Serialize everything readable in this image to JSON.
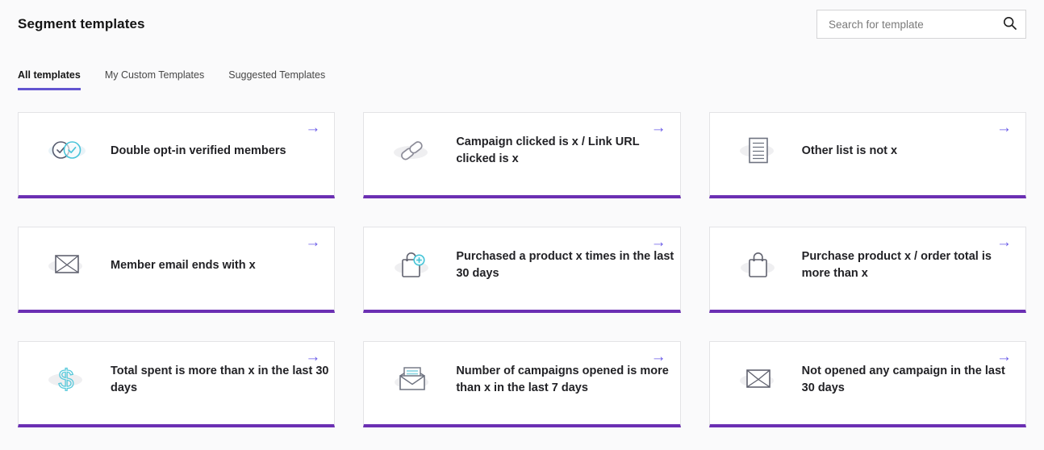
{
  "page": {
    "title": "Segment templates",
    "accent_border_color": "#6b2fb3",
    "arrow_color": "#6a5be8",
    "tab_underline_color": "#6254d0"
  },
  "search": {
    "placeholder": "Search for template",
    "value": "",
    "icon": "search-icon"
  },
  "tabs": [
    {
      "label": "All templates",
      "active": true
    },
    {
      "label": "My Custom Templates",
      "active": false
    },
    {
      "label": "Suggested Templates",
      "active": false
    }
  ],
  "card_arrow_glyph": "→",
  "cards": [
    {
      "title": "Double opt-in verified members",
      "icon": "double-optin-check-icon"
    },
    {
      "title": "Campaign clicked is x / Link URL clicked is x",
      "icon": "link-icon"
    },
    {
      "title": "Other list is not x",
      "icon": "list-document-icon"
    },
    {
      "title": "Member email ends with x",
      "icon": "envelope-icon"
    },
    {
      "title": "Purchased a product x times in the last 30 days",
      "icon": "shopping-bag-plus-icon"
    },
    {
      "title": "Purchase product x / order total is more than x",
      "icon": "shopping-bag-icon"
    },
    {
      "title": "Total spent is more than x in the last 30 days",
      "icon": "dollar-icon"
    },
    {
      "title": "Number of campaigns opened is more than x in the last 7 days",
      "icon": "envelope-open-icon"
    },
    {
      "title": "Not opened any campaign in the last 30 days",
      "icon": "envelope-icon"
    }
  ]
}
